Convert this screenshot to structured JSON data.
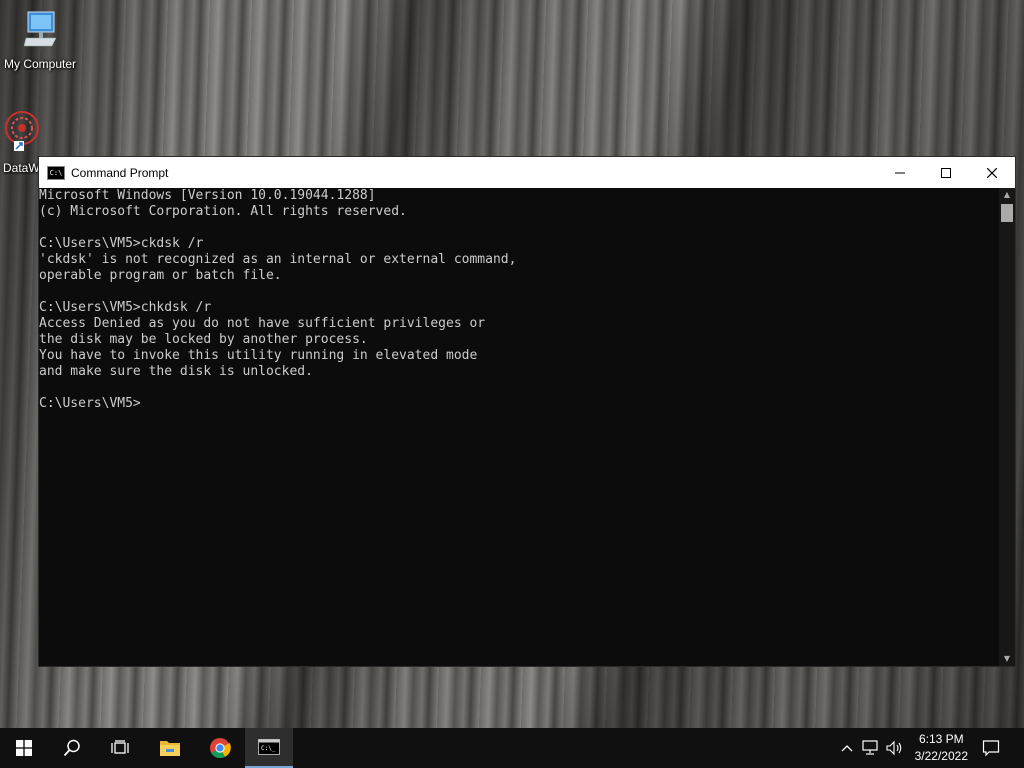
{
  "desktop": {
    "icons": [
      {
        "label": "My Computer"
      },
      {
        "label": "DataW"
      }
    ]
  },
  "window": {
    "title": "Command Prompt",
    "icon_text": "C:\\",
    "console_lines": [
      "Microsoft Windows [Version 10.0.19044.1288]",
      "(c) Microsoft Corporation. All rights reserved.",
      "",
      "C:\\Users\\VM5>ckdsk /r",
      "'ckdsk' is not recognized as an internal or external command,",
      "operable program or batch file.",
      "",
      "C:\\Users\\VM5>chkdsk /r",
      "Access Denied as you do not have sufficient privileges or",
      "the disk may be locked by another process.",
      "You have to invoke this utility running in elevated mode",
      "and make sure the disk is unlocked.",
      "",
      "C:\\Users\\VM5>"
    ]
  },
  "taskbar": {
    "apps": [
      "start-icon",
      "search-icon",
      "task-view-icon",
      "file-explorer-icon",
      "chrome-icon",
      "command-prompt-icon"
    ],
    "clock": {
      "time": "6:13 PM",
      "date": "3/22/2022"
    }
  },
  "colors": {
    "console_bg": "#0c0c0c",
    "console_text": "#cccccc",
    "taskbar_bg": "#101010"
  }
}
